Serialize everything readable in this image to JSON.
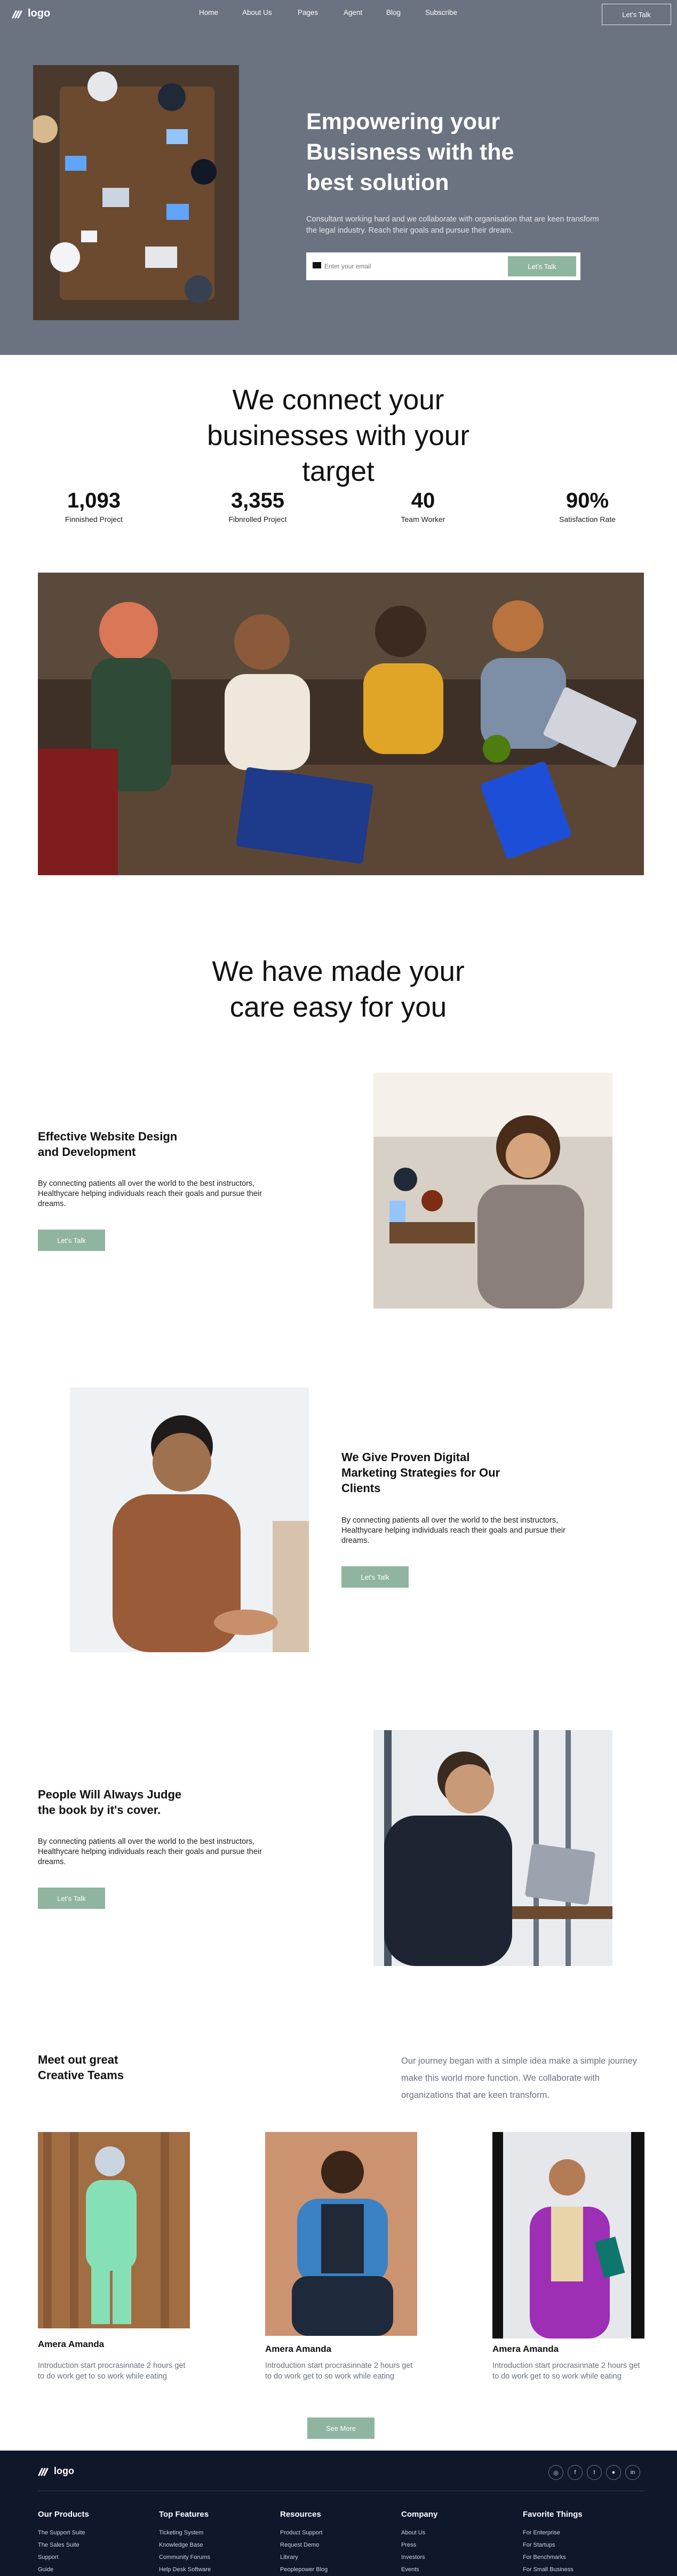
{
  "header": {
    "logo_text": "logo",
    "nav": [
      "Home",
      "About Us",
      "Pages",
      "Agent",
      "Blog",
      "Subscribe"
    ],
    "cta_label": "Let's Talk"
  },
  "hero": {
    "title": "Empowering your Busisness with the best solution",
    "description": "Consultant working hard and we collaborate with organisation that are keen transform the legal industry. Reach their goals and pursue their dream.",
    "email_placeholder": "Enter your email",
    "submit_label": "Let's Talk"
  },
  "connect": {
    "heading": "We connect your businesses with your target",
    "stats": [
      {
        "value": "1,093",
        "label": "Finnished Project"
      },
      {
        "value": "3,355",
        "label": "Fibnrolled Project"
      },
      {
        "value": "40",
        "label": "Team Worker"
      },
      {
        "value": "90%",
        "label": "Satisfaction Rate"
      }
    ]
  },
  "care": {
    "heading": "We have made your care easy for you"
  },
  "features": [
    {
      "title": "Effective Website Design and Development",
      "description": "By connecting patients all over the world to the best instructors, Healthycare helping individuals reach their goals and pursue their dreams.",
      "button": "Let's Talk"
    },
    {
      "title": "We Give Proven Digital Marketing Strategies for Our Clients",
      "description": "By connecting patients all over the world to the best instructors, Healthycare helping individuals reach their goals and pursue their dreams.",
      "button": "Let's Talk"
    },
    {
      "title": "People Will Always Judge the book by it's cover.",
      "description": "By connecting patients all over the world to the best instructors, Healthycare helping individuals reach their goals and pursue their dreams.",
      "button": "Let's Talk"
    }
  ],
  "team": {
    "heading": "Meet out great Creative Teams",
    "intro": "Our journey began with a simple idea make a simple journey make this world more function. We collaborate with organizations that are keen transform.",
    "members": [
      {
        "name": "Amera Amanda",
        "description": "Introduction start procrasinnate 2 hours get to do work get to so work while eating"
      },
      {
        "name": "Amera Amanda",
        "description": "Introduction start procrasinnate 2 hours get to do work get to so work while eating"
      },
      {
        "name": "Amera Amanda",
        "description": "Introduction start procrasinnate 2 hours get to do work get to so work while eating"
      }
    ],
    "see_more": "See More"
  },
  "footer": {
    "logo_text": "logo",
    "social_icons": [
      "instagram-icon",
      "facebook-icon",
      "twitter-icon",
      "github-icon",
      "linkedin-icon"
    ],
    "columns": [
      {
        "title": "Our Products",
        "items": [
          "The Support Suite",
          "The Sales Suite",
          "Support",
          "Guide"
        ]
      },
      {
        "title": "Top Features",
        "items": [
          "Ticketing System",
          "Knowledge Base",
          "Community Forums",
          "Help Desk Software"
        ]
      },
      {
        "title": "Resources",
        "items": [
          "Product Support",
          "Request Demo",
          "Library",
          "Peoplepower Blog"
        ]
      },
      {
        "title": "Company",
        "items": [
          "About Us",
          "Press",
          "Investors",
          "Events"
        ]
      },
      {
        "title": "Favorite Things",
        "items": [
          "For Enterprise",
          "For Startups",
          "For Benchmarks",
          "For Small Business"
        ]
      }
    ]
  },
  "colors": {
    "hero_bg": "#6b7280",
    "accent_green": "#8fb5a0",
    "footer_bg": "#0f172a"
  }
}
